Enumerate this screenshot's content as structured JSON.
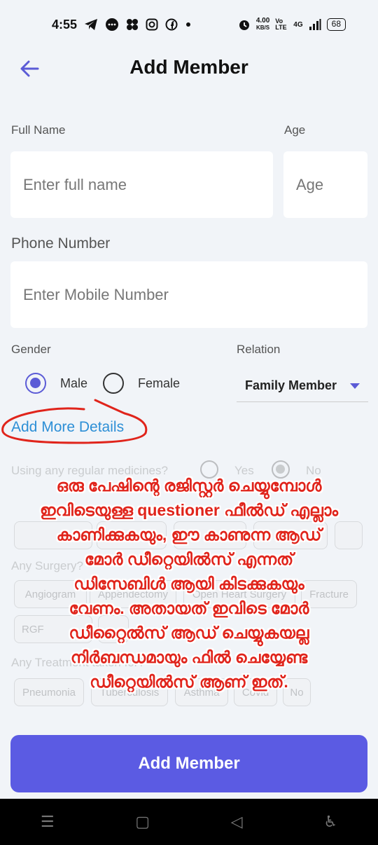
{
  "status_bar": {
    "time": "4:55",
    "speed_value": "4.00",
    "speed_unit": "KB/S",
    "network_a": "Vo LTE",
    "network_b": "4G",
    "battery": "68",
    "icons": [
      "telegram-icon",
      "chat-icon",
      "grid-icon",
      "instagram-icon",
      "facebook-icon",
      "dot-icon",
      "alarm-icon",
      "signal-icon"
    ]
  },
  "header": {
    "title": "Add Member",
    "back_icon": "arrow-left-icon"
  },
  "form": {
    "full_name_label": "Full Name",
    "full_name_placeholder": "Enter full name",
    "age_label": "Age",
    "age_placeholder": "Age",
    "phone_label": "Phone Number",
    "phone_placeholder": "Enter Mobile Number",
    "gender_label": "Gender",
    "gender_options": [
      "Male",
      "Female"
    ],
    "gender_selected": "Male",
    "relation_label": "Relation",
    "relation_value": "Family Member",
    "add_more_link": "Add More Details"
  },
  "questions": {
    "medicines_question": "Using any regular medicines?",
    "yes_label": "Yes",
    "no_label": "No",
    "surgery_question": "Any Surgery?",
    "surgery_chips": [
      "Angiogram",
      "Appendectomy",
      "Open Heart Surgery",
      "Fracture"
    ],
    "surgery_chip_extra": "RGF",
    "treatment_question": "Any Treatment taken for?",
    "treatment_chips": [
      "Pneumonia",
      "Tuberculosis",
      "Asthma",
      "Covid",
      "No"
    ]
  },
  "annotation": {
    "note_lines": [
      "ഒരു പേഷിന്റെ രജിസ്റ്റർ ചെയ്യുമ്പോൾ",
      "ഇവിടെയുള്ള questioner ഫീൽഡ് എല്ലാം",
      "കാണിക്കുകയും, ഈ കാണുന്ന ആഡ്",
      "മോർ ഡീറ്റെയിൽസ് എന്നത്",
      "ഡിസേബിൾ ആയി കിടക്കുകയും",
      "വേണം. അതായത് ഇവിടെ മോർ",
      "ഡീറ്റൈൽസ് ആഡ് ചെയ്യുകയല്ല",
      "നിർബന്ധമായും ഫിൽ ചെയ്യേണ്ട",
      "ഡീറ്റെയിൽസ് ആണ് ഇത്."
    ],
    "color": "#e0241b"
  },
  "submit_label": "Add Member",
  "accent_color": "#5b5be3",
  "nav": {
    "icons": [
      "menu-icon",
      "home-icon",
      "back-triangle-icon",
      "accessibility-icon"
    ],
    "menu_glyph": "☰",
    "home_glyph": "▢",
    "back_glyph": "◁",
    "access_glyph": "♿"
  }
}
